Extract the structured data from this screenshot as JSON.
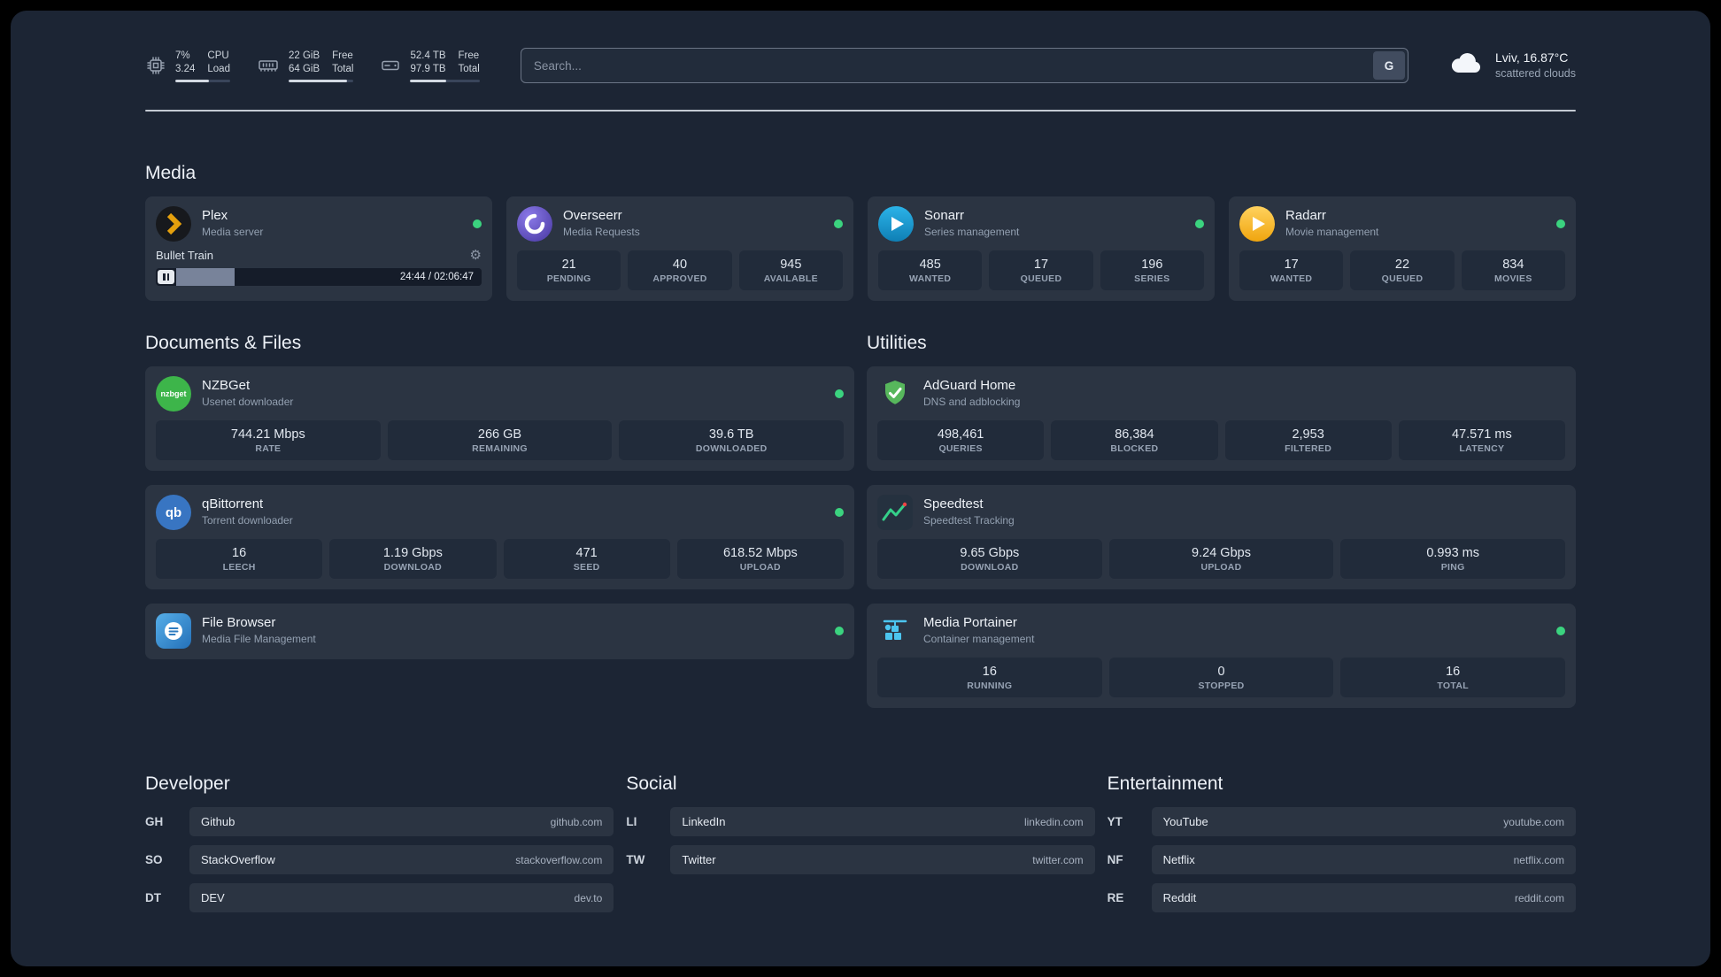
{
  "icons": {
    "gear": "⚙"
  },
  "colors": {
    "page_bg": "#1c2534",
    "card_bg": "#2b3442",
    "tile_bg": "#212b3a",
    "status_green": "#3bd37f",
    "plex_amber": "#e5a00d",
    "sonarr_blue": "#1b9ae0",
    "radarr_yellow": "#ffc230",
    "nzbget_green": "#3db54a",
    "qbittorrent_blue": "#3875c2",
    "adguard_green": "#57b75c",
    "overseerr_purple": "#5b48c4",
    "portainer_blue": "#4cc5ef",
    "speedtest_green": "#35d08a"
  },
  "topbar": {
    "resources": [
      {
        "icon": "cpu-icon",
        "value_top": "7%",
        "value_bottom": "3.24",
        "label_top": "CPU",
        "label_bottom": "Load",
        "progress": 62
      },
      {
        "icon": "memory-icon",
        "value_top": "22 GiB",
        "value_bottom": "64 GiB",
        "label_top": "Free",
        "label_bottom": "Total",
        "progress": 90
      },
      {
        "icon": "disk-icon",
        "value_top": "52.4 TB",
        "value_bottom": "97.9 TB",
        "label_top": "Free",
        "label_bottom": "Total",
        "progress": 52
      }
    ],
    "search": {
      "placeholder": "Search...",
      "button_label": "G"
    },
    "weather": {
      "location": "Lviv, 16.87°C",
      "condition": "scattered clouds"
    }
  },
  "sections": {
    "media": {
      "title": "Media",
      "services": [
        {
          "name": "Plex",
          "subtitle": "Media server",
          "icon": "plex-icon",
          "status": "online",
          "player": {
            "track": "Bullet Train",
            "time": "24:44 / 02:06:47",
            "progress": 19
          }
        },
        {
          "name": "Overseerr",
          "subtitle": "Media Requests",
          "icon": "overseerr-icon",
          "status": "online",
          "stats": [
            {
              "value": "21",
              "label": "PENDING"
            },
            {
              "value": "40",
              "label": "APPROVED"
            },
            {
              "value": "945",
              "label": "AVAILABLE"
            }
          ]
        },
        {
          "name": "Sonarr",
          "subtitle": "Series management",
          "icon": "sonarr-icon",
          "status": "online",
          "stats": [
            {
              "value": "485",
              "label": "WANTED"
            },
            {
              "value": "17",
              "label": "QUEUED"
            },
            {
              "value": "196",
              "label": "SERIES"
            }
          ]
        },
        {
          "name": "Radarr",
          "subtitle": "Movie management",
          "icon": "radarr-icon",
          "status": "online",
          "stats": [
            {
              "value": "17",
              "label": "WANTED"
            },
            {
              "value": "22",
              "label": "QUEUED"
            },
            {
              "value": "834",
              "label": "MOVIES"
            }
          ]
        }
      ]
    },
    "documents": {
      "title": "Documents & Files",
      "services": [
        {
          "name": "NZBGet",
          "subtitle": "Usenet downloader",
          "icon": "nzbget-icon",
          "icon_text": "nzbget",
          "status": "online",
          "stats": [
            {
              "value": "744.21 Mbps",
              "label": "RATE"
            },
            {
              "value": "266 GB",
              "label": "REMAINING"
            },
            {
              "value": "39.6 TB",
              "label": "DOWNLOADED"
            }
          ]
        },
        {
          "name": "qBittorrent",
          "subtitle": "Torrent downloader",
          "icon": "qbittorrent-icon",
          "icon_text": "qb",
          "status": "online",
          "stats": [
            {
              "value": "16",
              "label": "LEECH"
            },
            {
              "value": "1.19 Gbps",
              "label": "DOWNLOAD"
            },
            {
              "value": "471",
              "label": "SEED"
            },
            {
              "value": "618.52 Mbps",
              "label": "UPLOAD"
            }
          ]
        },
        {
          "name": "File Browser",
          "subtitle": "Media File Management",
          "icon": "filebrowser-icon",
          "status": "online"
        }
      ]
    },
    "utilities": {
      "title": "Utilities",
      "services": [
        {
          "name": "AdGuard Home",
          "subtitle": "DNS and adblocking",
          "icon": "adguard-icon",
          "stats": [
            {
              "value": "498,461",
              "label": "QUERIES"
            },
            {
              "value": "86,384",
              "label": "BLOCKED"
            },
            {
              "value": "2,953",
              "label": "FILTERED"
            },
            {
              "value": "47.571 ms",
              "label": "LATENCY"
            }
          ]
        },
        {
          "name": "Speedtest",
          "subtitle": "Speedtest Tracking",
          "icon": "speedtest-icon",
          "stats": [
            {
              "value": "9.65 Gbps",
              "label": "DOWNLOAD"
            },
            {
              "value": "9.24 Gbps",
              "label": "UPLOAD"
            },
            {
              "value": "0.993 ms",
              "label": "PING"
            }
          ]
        },
        {
          "name": "Media Portainer",
          "subtitle": "Container management",
          "icon": "portainer-icon",
          "status": "online",
          "stats": [
            {
              "value": "16",
              "label": "RUNNING"
            },
            {
              "value": "0",
              "label": "STOPPED"
            },
            {
              "value": "16",
              "label": "TOTAL"
            }
          ]
        }
      ]
    }
  },
  "bookmarks": {
    "developer": {
      "title": "Developer",
      "items": [
        {
          "abbr": "GH",
          "name": "Github",
          "url": "github.com"
        },
        {
          "abbr": "SO",
          "name": "StackOverflow",
          "url": "stackoverflow.com"
        },
        {
          "abbr": "DT",
          "name": "DEV",
          "url": "dev.to"
        }
      ]
    },
    "social": {
      "title": "Social",
      "items": [
        {
          "abbr": "LI",
          "name": "LinkedIn",
          "url": "linkedin.com"
        },
        {
          "abbr": "TW",
          "name": "Twitter",
          "url": "twitter.com"
        }
      ]
    },
    "entertainment": {
      "title": "Entertainment",
      "items": [
        {
          "abbr": "YT",
          "name": "YouTube",
          "url": "youtube.com"
        },
        {
          "abbr": "NF",
          "name": "Netflix",
          "url": "netflix.com"
        },
        {
          "abbr": "RE",
          "name": "Reddit",
          "url": "reddit.com"
        }
      ]
    }
  }
}
